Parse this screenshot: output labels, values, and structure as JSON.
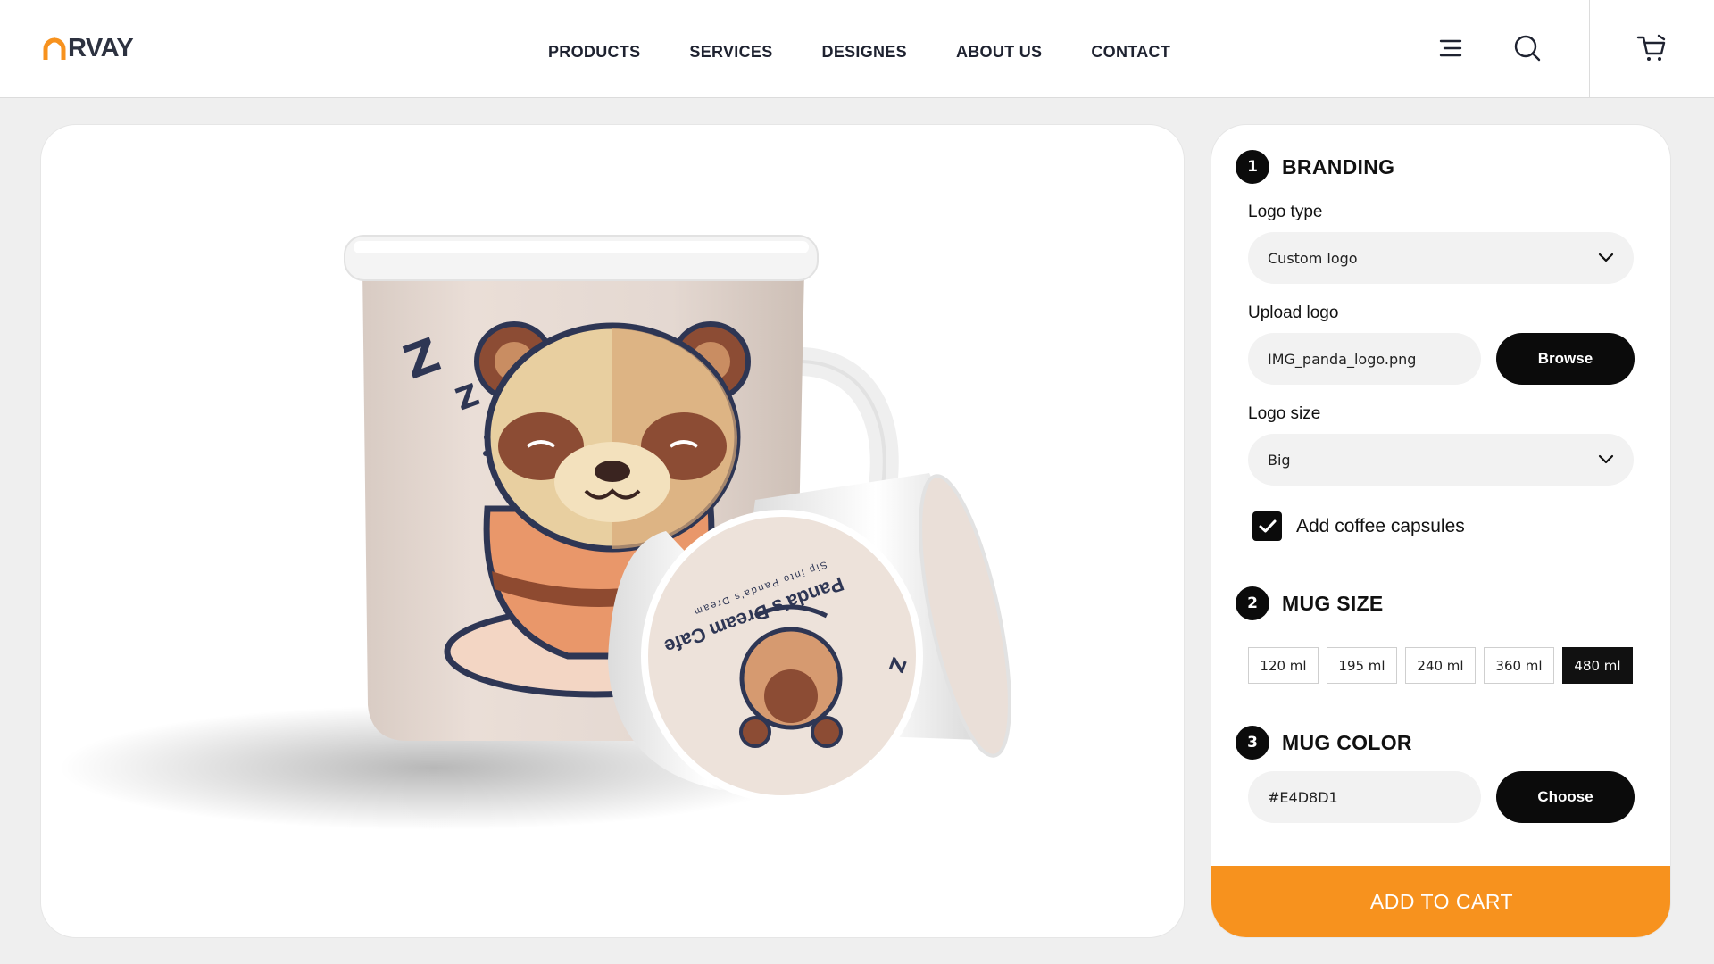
{
  "brand": {
    "name": "RVAY",
    "accent": "#f7921e"
  },
  "nav": {
    "items": [
      "PRODUCTS",
      "SERVICES",
      "DESIGNES",
      "ABOUT US",
      "CONTACT"
    ]
  },
  "header_icons": [
    "menu-icon",
    "search-icon",
    "cart-icon"
  ],
  "preview": {
    "mug_color": "#E4D8D1",
    "capsule_text": "Panda's Dream Cafe",
    "capsule_subtext": "Sip into Panda's Dream"
  },
  "branding": {
    "step": "1",
    "title": "BRANDING",
    "logo_type_label": "Logo type",
    "logo_type_value": "Custom logo",
    "upload_label": "Upload logo",
    "upload_value": "IMG_panda_logo.png",
    "browse_label": "Browse",
    "logo_size_label": "Logo size",
    "logo_size_value": "Big",
    "capsules_label": "Add coffee capsules",
    "capsules_checked": true
  },
  "mug_size": {
    "step": "2",
    "title": "MUG SIZE",
    "options": [
      "120 ml",
      "195 ml",
      "240 ml",
      "360 ml",
      "480 ml"
    ],
    "selected": "480 ml"
  },
  "mug_color": {
    "step": "3",
    "title": "MUG COLOR",
    "value": "#E4D8D1",
    "choose_label": "Choose"
  },
  "add_to_cart_label": "ADD TO CART"
}
